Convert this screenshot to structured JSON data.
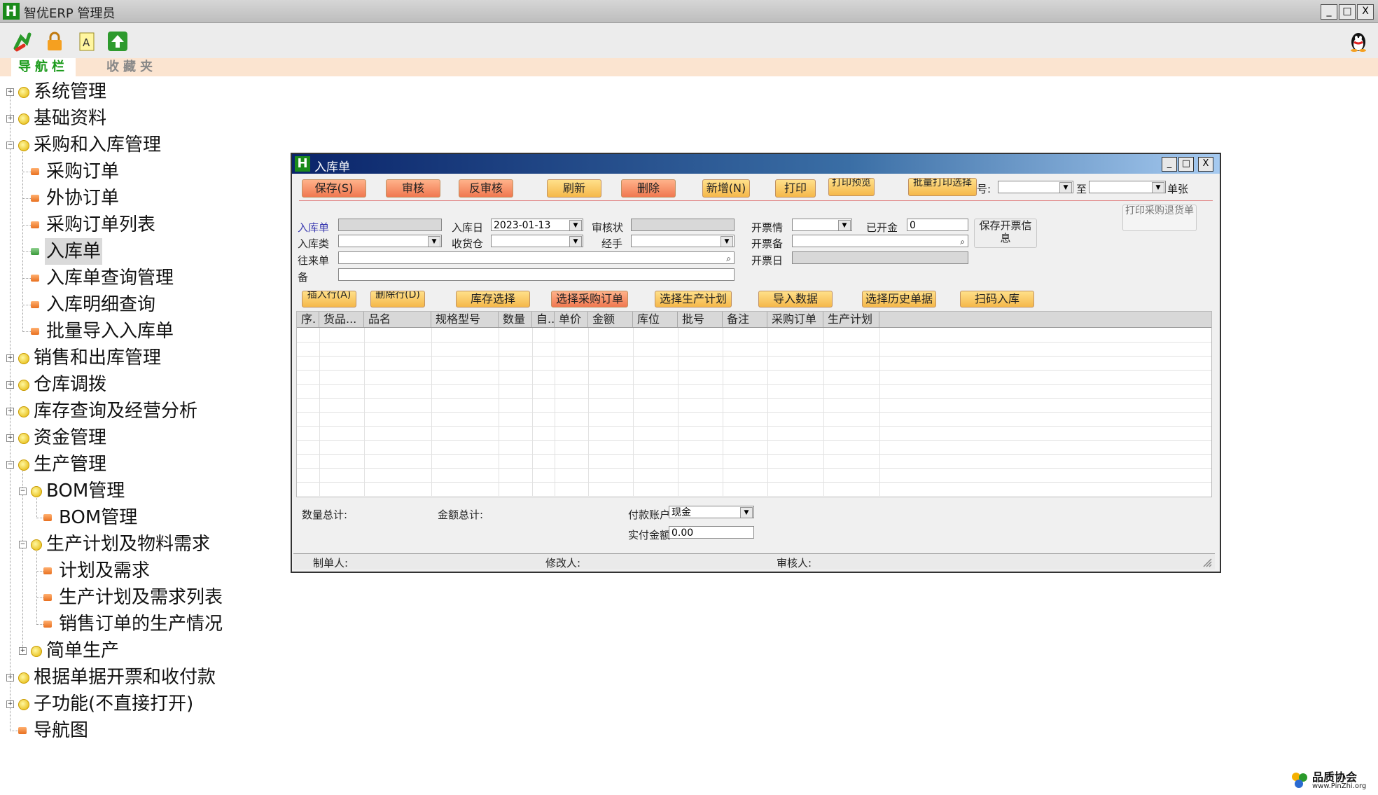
{
  "app": {
    "title": "智优ERP 管理员",
    "logo_letter": "H",
    "window_buttons": [
      "_",
      "□",
      "X"
    ]
  },
  "toolbar": {
    "icons": [
      "refresh-arrow-icon",
      "lock-icon",
      "text-document-icon",
      "upload-arrow-icon"
    ],
    "qq_icon": "qq-penguin-icon"
  },
  "nav": {
    "tabs": [
      "导航栏",
      "收藏夹"
    ]
  },
  "tree": {
    "items": [
      {
        "label": "系统管理"
      },
      {
        "label": "基础资料"
      },
      {
        "label": "采购和入库管理"
      },
      {
        "label": "采购订单"
      },
      {
        "label": "外协订单"
      },
      {
        "label": "采购订单列表"
      },
      {
        "label": "入库单"
      },
      {
        "label": "入库单查询管理"
      },
      {
        "label": "入库明细查询"
      },
      {
        "label": "批量导入入库单"
      },
      {
        "label": "销售和出库管理"
      },
      {
        "label": "仓库调拨"
      },
      {
        "label": "库存查询及经营分析"
      },
      {
        "label": "资金管理"
      },
      {
        "label": "生产管理"
      },
      {
        "label": "BOM管理"
      },
      {
        "label": "BOM管理"
      },
      {
        "label": "生产计划及物料需求"
      },
      {
        "label": "计划及需求"
      },
      {
        "label": "生产计划及需求列表"
      },
      {
        "label": "销售订单的生产情况"
      },
      {
        "label": "简单生产"
      },
      {
        "label": "根据单据开票和收付款"
      },
      {
        "label": "子功能(不直接打开)"
      },
      {
        "label": "导航图"
      }
    ]
  },
  "child": {
    "title": "入库单",
    "logo_letter": "H",
    "window_buttons": [
      "_",
      "□",
      "X"
    ],
    "toolbar": {
      "buttons": [
        "保存(S)",
        "审核",
        "反审核",
        "刷新",
        "删除",
        "新增(N)",
        "打印",
        "打印预览",
        "批量打印选择"
      ],
      "no_label": "号:",
      "to_label": "至",
      "single_label": "单张",
      "print_return": "打印采购退货单"
    },
    "form": {
      "receipt_no_label": "入库单",
      "receipt_no_value": "",
      "date_label": "入库日",
      "date_value": "2023-01-13",
      "audit_status_label": "审核状",
      "audit_status_value": "",
      "invoice_status_label": "开票情",
      "invoiced_amount_label": "已开金",
      "invoiced_amount_value": "0",
      "save_invoice_button": "保存开票信息",
      "type_label": "入库类",
      "warehouse_label": "收货仓",
      "handler_label": "经手",
      "invoice_note_label": "开票备",
      "partner_label": "往来单",
      "invoice_date_label": "开票日",
      "note_label": "备"
    },
    "actions": [
      "插入行(A)",
      "删除行(D)",
      "库存选择",
      "选择采购订单",
      "选择生产计划",
      "导入数据",
      "选择历史单据",
      "扫码入库"
    ],
    "table": {
      "columns": [
        "序.",
        "货品...",
        "品名",
        "规格型号",
        "数量",
        "自..",
        "单价",
        "金额",
        "库位",
        "批号",
        "备注",
        "采购订单",
        "生产计划"
      ],
      "rows": []
    },
    "footer": {
      "qty_total_label": "数量总计:",
      "amount_total_label": "金额总计:",
      "pay_account_label": "付款账户",
      "pay_account_value": "现金",
      "paid_amount_label": "实付金额",
      "paid_amount_value": "0.00"
    },
    "status": {
      "creator_label": "制单人:",
      "modifier_label": "修改人:",
      "auditor_label": "审核人:"
    }
  },
  "watermark": {
    "name": "品质协会",
    "url": "www.PinZhi.org"
  }
}
